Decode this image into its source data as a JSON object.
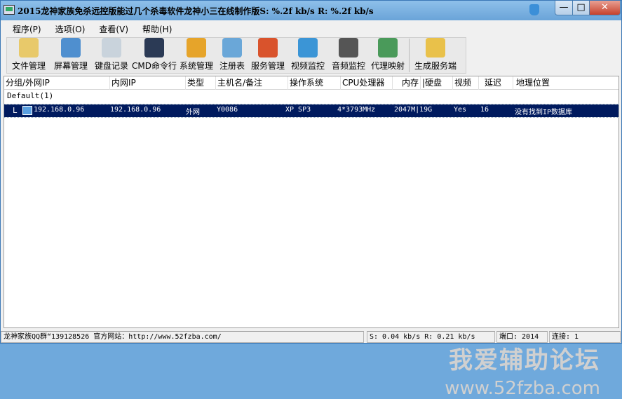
{
  "window": {
    "title": "2015龙神家族免杀远控版能过几个杀毒软件龙神小三在线制作版S: %.2f kb/s R: %.2f kb/s",
    "min_label": "—",
    "max_label": "□",
    "close_label": "✕"
  },
  "menu": [
    "程序(P)",
    "选项(O)",
    "查看(V)",
    "帮助(H)"
  ],
  "toolbar": [
    {
      "label": "文件管理",
      "icon": "folder-icon",
      "color": "#e8c96a"
    },
    {
      "label": "屏幕管理",
      "icon": "screen-icon",
      "color": "#4f8fcf"
    },
    {
      "label": "键盘记录",
      "icon": "keyboard-icon",
      "color": "#c9d3dc"
    },
    {
      "label": "CMD命令行",
      "icon": "cmd-icon",
      "color": "#2b3a55"
    },
    {
      "label": "系统管理",
      "icon": "gear-icon",
      "color": "#e6a42a"
    },
    {
      "label": "注册表",
      "icon": "registry-icon",
      "color": "#6aa7d8"
    },
    {
      "label": "服务管理",
      "icon": "windows-icon",
      "color": "#d9532c"
    },
    {
      "label": "视频监控",
      "icon": "webcam-icon",
      "color": "#3b95d6"
    },
    {
      "label": "音频监控",
      "icon": "headset-icon",
      "color": "#555555"
    },
    {
      "label": "代理映射",
      "icon": "globe-icon",
      "color": "#4a9a5a"
    },
    {
      "label": "生成服务端",
      "icon": "package-icon",
      "color": "#e9c14a"
    }
  ],
  "columns": [
    "分组/外网IP",
    "内网IP",
    "类型",
    "主机名/备注",
    "操作系统",
    "CPU处理器",
    "内存",
    "|硬盘",
    "视频",
    "延迟",
    "地理位置"
  ],
  "group": "Default(1)",
  "rows": [
    {
      "tree": "L",
      "ext_ip": "192.168.0.96",
      "int_ip": "192.168.0.96",
      "type": "外网",
      "host": "Y0086",
      "os": "XP SP3",
      "cpu": "4*3793MHz",
      "mem_disk": "2047M|19G",
      "video": "Yes",
      "ping": "16",
      "location": "没有找到IP数据库"
    }
  ],
  "watermark": {
    "line1": "我爱辅助论坛",
    "line2": "www.52fzba.com"
  },
  "status": {
    "contact": "龙神家族QQ群“139128526  官方网站：http://www.52fzba.com/",
    "speed": "S: 0.04 kb/s R: 0.21 kb/s",
    "port": "端口: 2014",
    "connections": "连接: 1"
  }
}
